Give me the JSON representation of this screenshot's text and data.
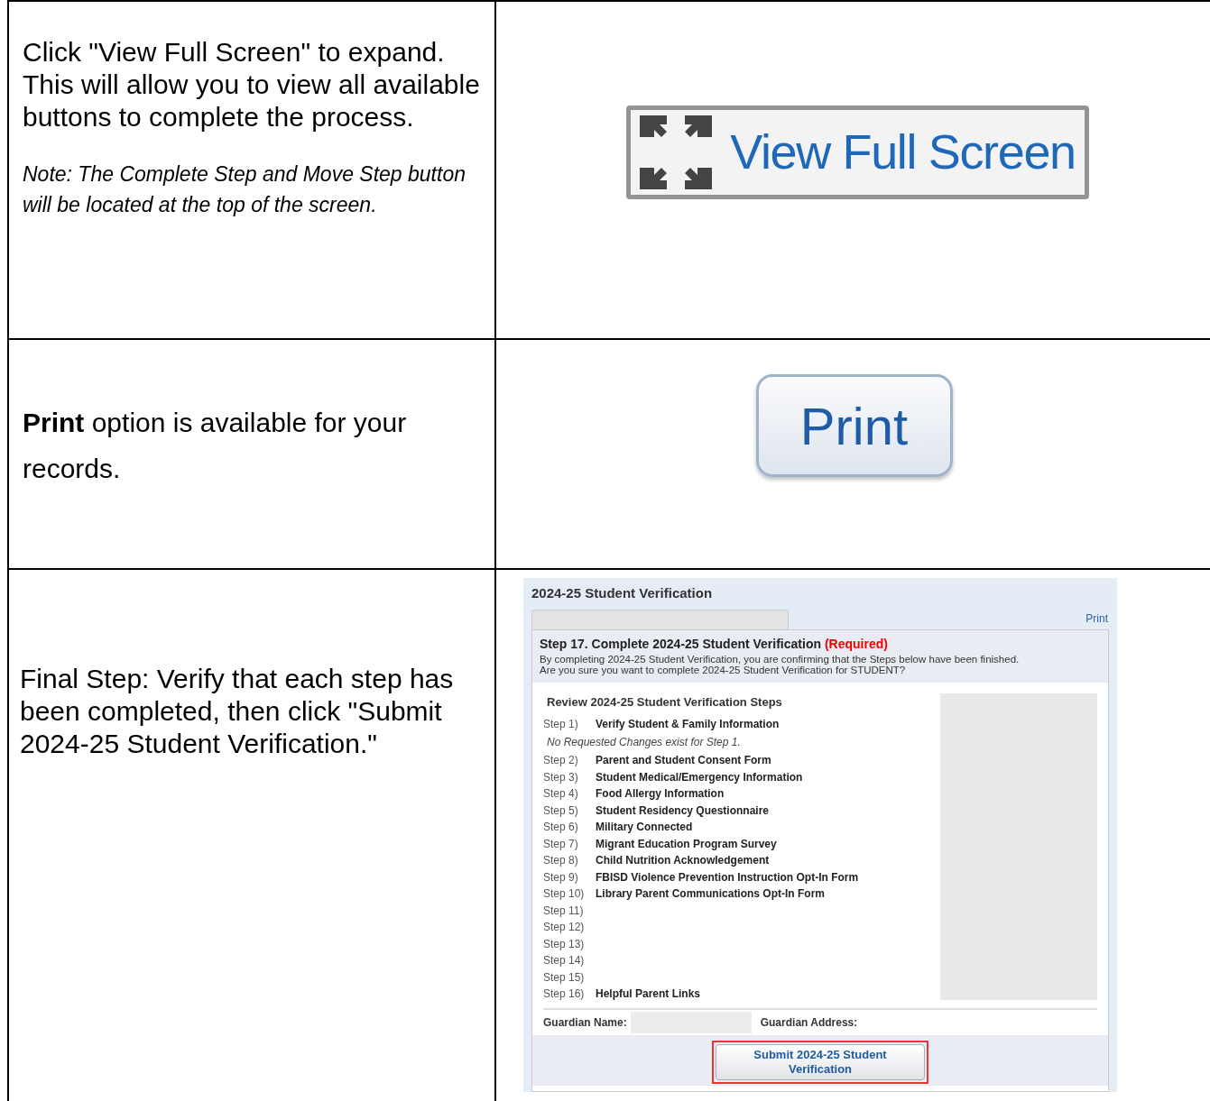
{
  "rows": [
    {
      "text": "Click \"View Full Screen\" to expand. This will allow you to view all available buttons to complete the process.",
      "note": "Note:  The Complete Step and Move Step button will be located at the top of the screen.",
      "kind": "fullscreen",
      "button": "View Full Screen"
    },
    {
      "text": "**Print** option is available for your records.",
      "kind": "print",
      "button": "Print"
    },
    {
      "text": "Final Step:  Verify that each step has been completed, then click \"Submit 2024-25 Student Verification.\"",
      "kind": "screenshot"
    }
  ],
  "verification_screen": {
    "title": "2024-25 Student Verification",
    "print_link": "Print",
    "step_title": "Step 17. Complete 2024-25 Student Verification",
    "required": "(Required)",
    "description": [
      "By completing 2024-25 Student Verification, you are confirming that the Steps below have been finished.",
      "Are you sure you want to complete 2024-25 Student Verification for STUDENT?"
    ],
    "review_heading": "Review 2024-25 Student Verification Steps",
    "steps": [
      {
        "number": "Step 1)",
        "label": "Verify Student & Family Information",
        "note": "No Requested Changes exist for Step 1."
      },
      {
        "number": "Step 2)",
        "label": "Parent and Student Consent Form"
      },
      {
        "number": "Step 3)",
        "label": "Student Medical/Emergency Information"
      },
      {
        "number": "Step 4)",
        "label": "Food Allergy Information"
      },
      {
        "number": "Step 5)",
        "label": "Student Residency Questionnaire"
      },
      {
        "number": "Step 6)",
        "label": "Military Connected"
      },
      {
        "number": "Step 7)",
        "label": "Migrant Education Program Survey"
      },
      {
        "number": "Step 8)",
        "label": "Child Nutrition Acknowledgement"
      },
      {
        "number": "Step 9)",
        "label": "FBISD Violence Prevention Instruction Opt-In Form"
      },
      {
        "number": "Step 10)",
        "label": "Library Parent Communications Opt-In Form"
      },
      {
        "number": "Step 11)"
      },
      {
        "number": "Step 12)"
      },
      {
        "number": "Step 13)"
      },
      {
        "number": "Step 14)"
      },
      {
        "number": "Step 15)"
      },
      {
        "number": "Step 16)",
        "label": "Helpful Parent Links"
      }
    ],
    "guardian_name_label": "Guardian Name:",
    "guardian_address_label": "Guardian Address:",
    "submit_button": "Submit 2024-25 Student Verification"
  }
}
